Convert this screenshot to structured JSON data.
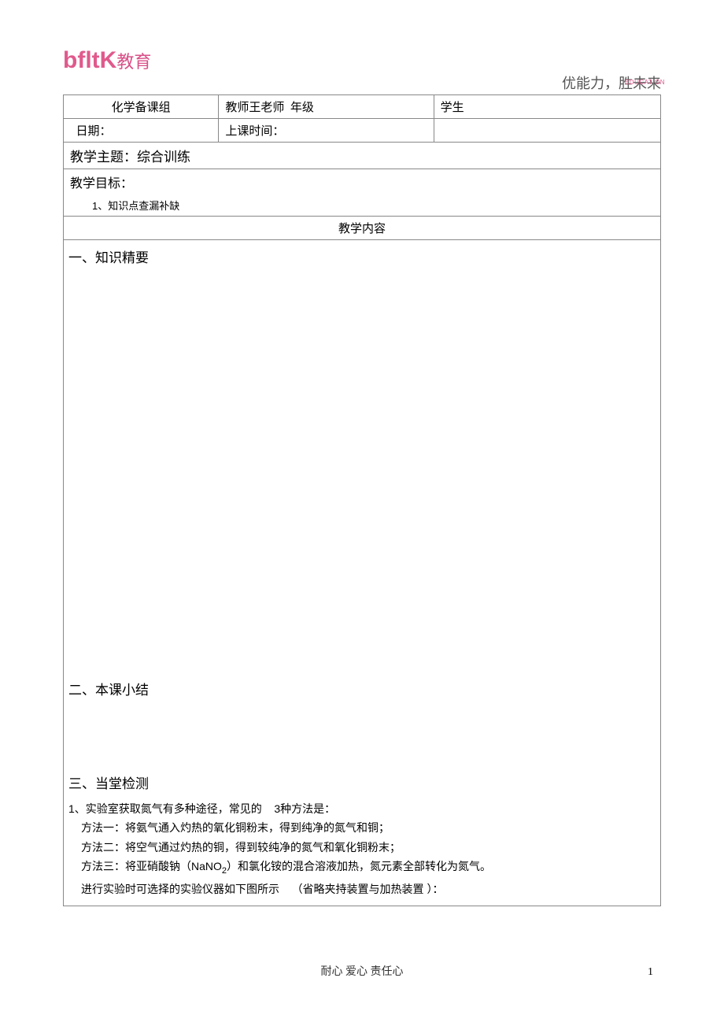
{
  "header": {
    "logo_en": "bfltK",
    "logo_cn": "教育",
    "slogan": "优能力，胜未来",
    "slogan_en_suffix": "EDUCATION"
  },
  "info_row1": {
    "group": "化学备课组",
    "teacher_label": "教师",
    "teacher_name": "王老师",
    "grade_label": "年级",
    "student_label": "学生"
  },
  "info_row2": {
    "date_label": "日期：",
    "time_label": "上课时间："
  },
  "theme": {
    "label": "教学主题：",
    "value": "综合训练"
  },
  "goals": {
    "label": "教学目标：",
    "item1": "1、知识点查漏补缺"
  },
  "content_header": "教学内容",
  "sections": {
    "s1": "一、知识精要",
    "s2": "二、本课小结",
    "s3": "三、当堂检测"
  },
  "question1": {
    "intro_a": "1、实验室获取氮气有多种途径，常见的",
    "intro_b": "3种方法是：",
    "m1": "方法一：将氨气通入灼热的氧化铜粉末，得到纯净的氮气和铜；",
    "m2": "方法二：将空气通过灼热的铜，得到较纯净的氮气和氧化铜粉末；",
    "m3_a": "方法三：将亚硝酸钠（NaNO",
    "m3_sub": "2",
    "m3_b": "）和氯化铵的混合溶液加热，氮元素全部转化为氮气。",
    "note_a": "进行实验时可选择的实验仪器如下图所示",
    "note_b": "（省略夹持装置与加热装置 ）："
  },
  "footer": "耐心  爱心  责任心",
  "page_num": "1"
}
